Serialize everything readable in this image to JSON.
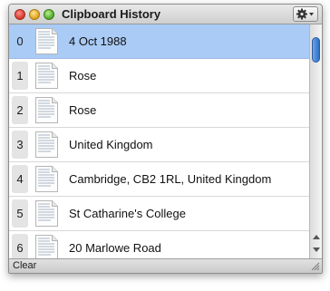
{
  "window": {
    "title": "Clipboard History"
  },
  "toolbar": {
    "action_menu_icon": "gear-icon"
  },
  "history": [
    {
      "index": "0",
      "text": "4 Oct 1988",
      "selected": true
    },
    {
      "index": "1",
      "text": "Rose",
      "selected": false
    },
    {
      "index": "2",
      "text": "Rose",
      "selected": false
    },
    {
      "index": "3",
      "text": "United Kingdom",
      "selected": false
    },
    {
      "index": "4",
      "text": "Cambridge, CB2 1RL, United Kingdom",
      "selected": false
    },
    {
      "index": "5",
      "text": "St Catharine's College",
      "selected": false
    },
    {
      "index": "6",
      "text": "20 Marlowe Road",
      "selected": false
    }
  ],
  "footer": {
    "clear_label": "Clear"
  },
  "colors": {
    "selection": "#a9cbf5",
    "scroll_thumb": "#2c6fc7"
  }
}
